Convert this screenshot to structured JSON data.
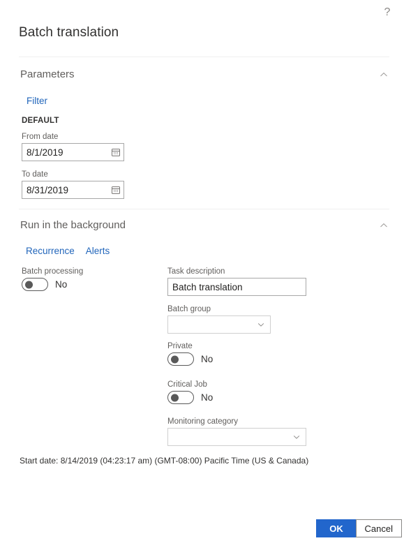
{
  "dialog": {
    "title": "Batch translation",
    "help_icon": "question-mark-icon"
  },
  "parameters_section": {
    "title": "Parameters",
    "collapse_icon": "chevron-up-icon",
    "filter_link": "Filter",
    "default_label": "DEFAULT",
    "fields": {
      "from_date": {
        "label": "From date",
        "value": "8/1/2019",
        "icon": "calendar-icon"
      },
      "to_date": {
        "label": "To date",
        "value": "8/31/2019",
        "icon": "calendar-icon"
      }
    }
  },
  "background_section": {
    "title": "Run in the background",
    "collapse_icon": "chevron-up-icon",
    "tabs": [
      {
        "label": "Recurrence"
      },
      {
        "label": "Alerts"
      }
    ],
    "batch_processing": {
      "label": "Batch processing",
      "state": "No"
    },
    "task_description": {
      "label": "Task description",
      "value": "Batch translation",
      "placeholder": ""
    },
    "batch_group": {
      "label": "Batch group",
      "value": "",
      "icon": "chevron-down-icon"
    },
    "private": {
      "label": "Private",
      "state": "No"
    },
    "critical_job": {
      "label": "Critical Job",
      "state": "No"
    },
    "monitoring_category": {
      "label": "Monitoring category",
      "value": "",
      "icon": "chevron-down-icon"
    },
    "start_date_text": "Start date: 8/14/2019 (04:23:17 am) (GMT-08:00) Pacific Time (US & Canada)"
  },
  "footer": {
    "ok_label": "OK",
    "cancel_label": "Cancel"
  },
  "colors": {
    "accent": "#2266cc",
    "link": "#2266bb",
    "text": "#323130",
    "label": "#605e5c",
    "border": "#a8a8a8"
  }
}
